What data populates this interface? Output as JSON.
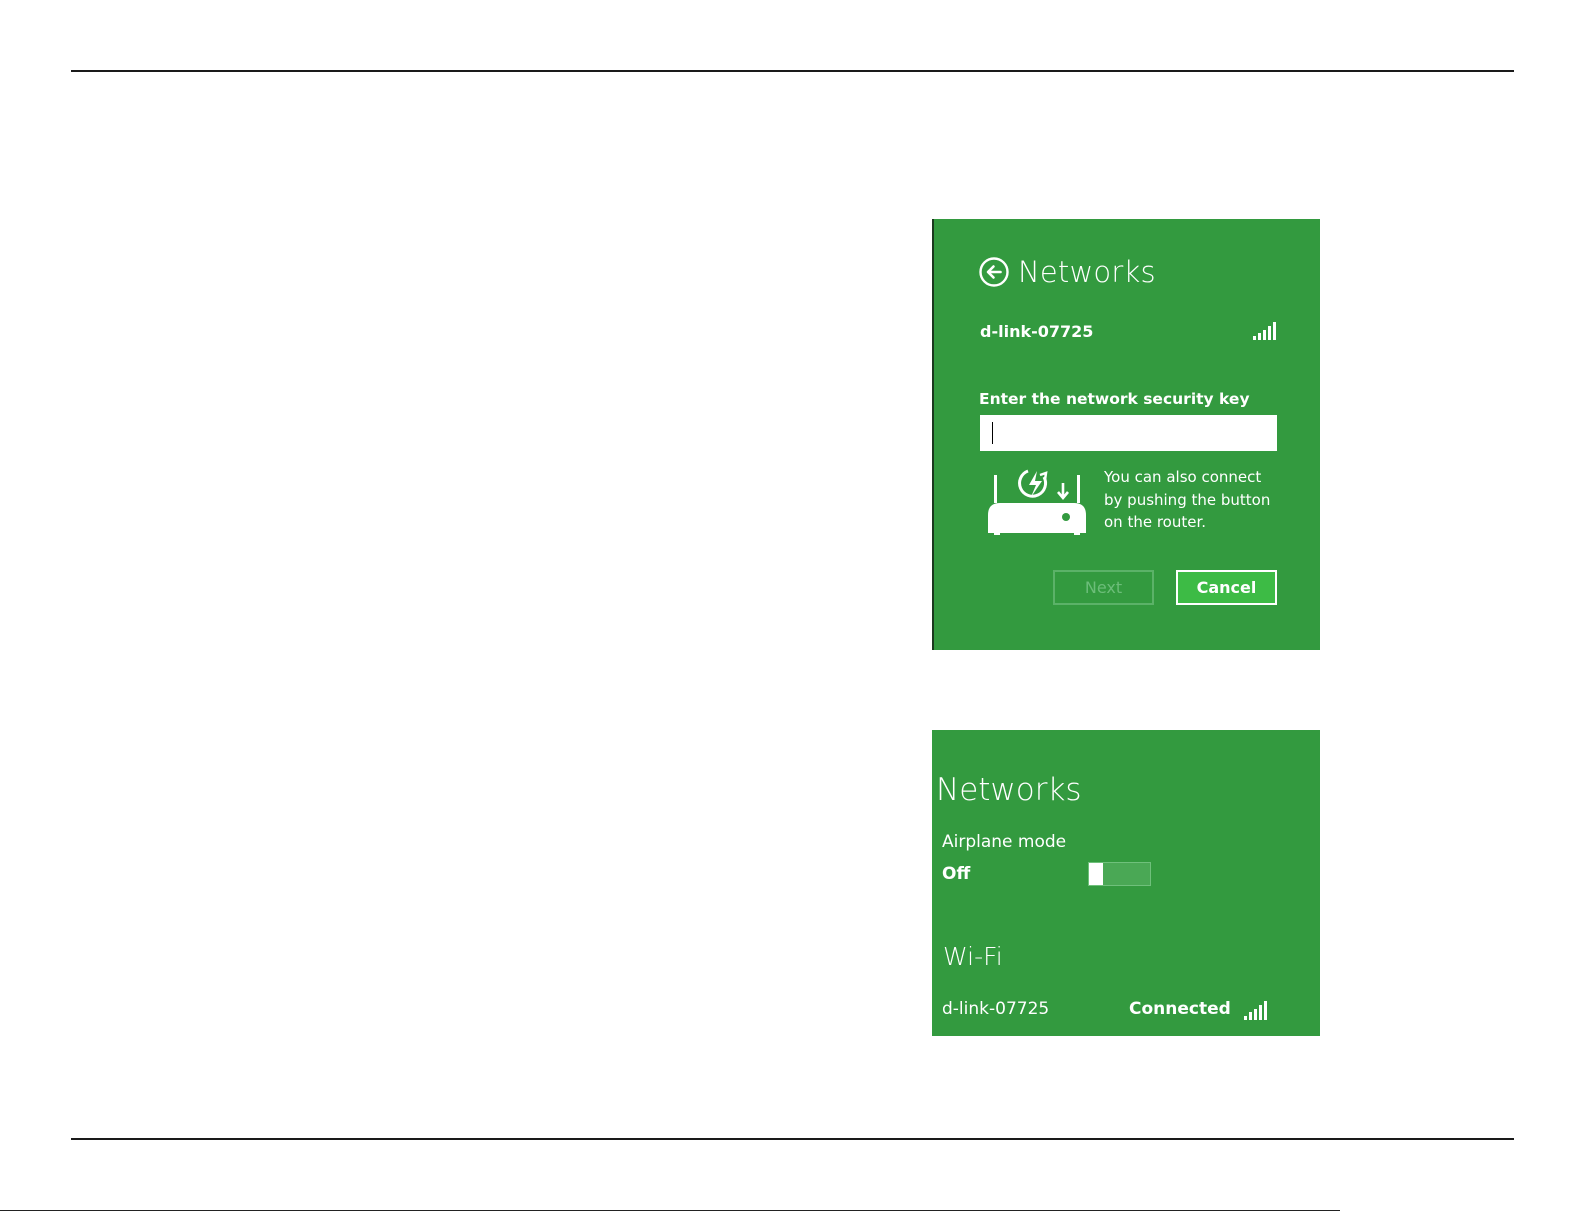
{
  "theme": {
    "green": "#339a3f",
    "white": "#ffffff"
  },
  "dialog": {
    "title": "Networks",
    "back_icon": "back-arrow-circle-icon",
    "ssid": "d-link-07725",
    "signal_icon": "signal-strength-icon",
    "key_label": "Enter the network security key",
    "key_value": "",
    "router_icon": "router-wps-icon",
    "wps_hint": "You can also connect by pushing the button on the router.",
    "next_label": "Next",
    "cancel_label": "Cancel"
  },
  "flyout": {
    "title": "Networks",
    "airplane_label": "Airplane mode",
    "airplane_state": "Off",
    "airplane_on": false,
    "wifi_heading": "Wi-Fi",
    "ssid": "d-link-07725",
    "status": "Connected",
    "signal_icon": "signal-strength-icon"
  }
}
